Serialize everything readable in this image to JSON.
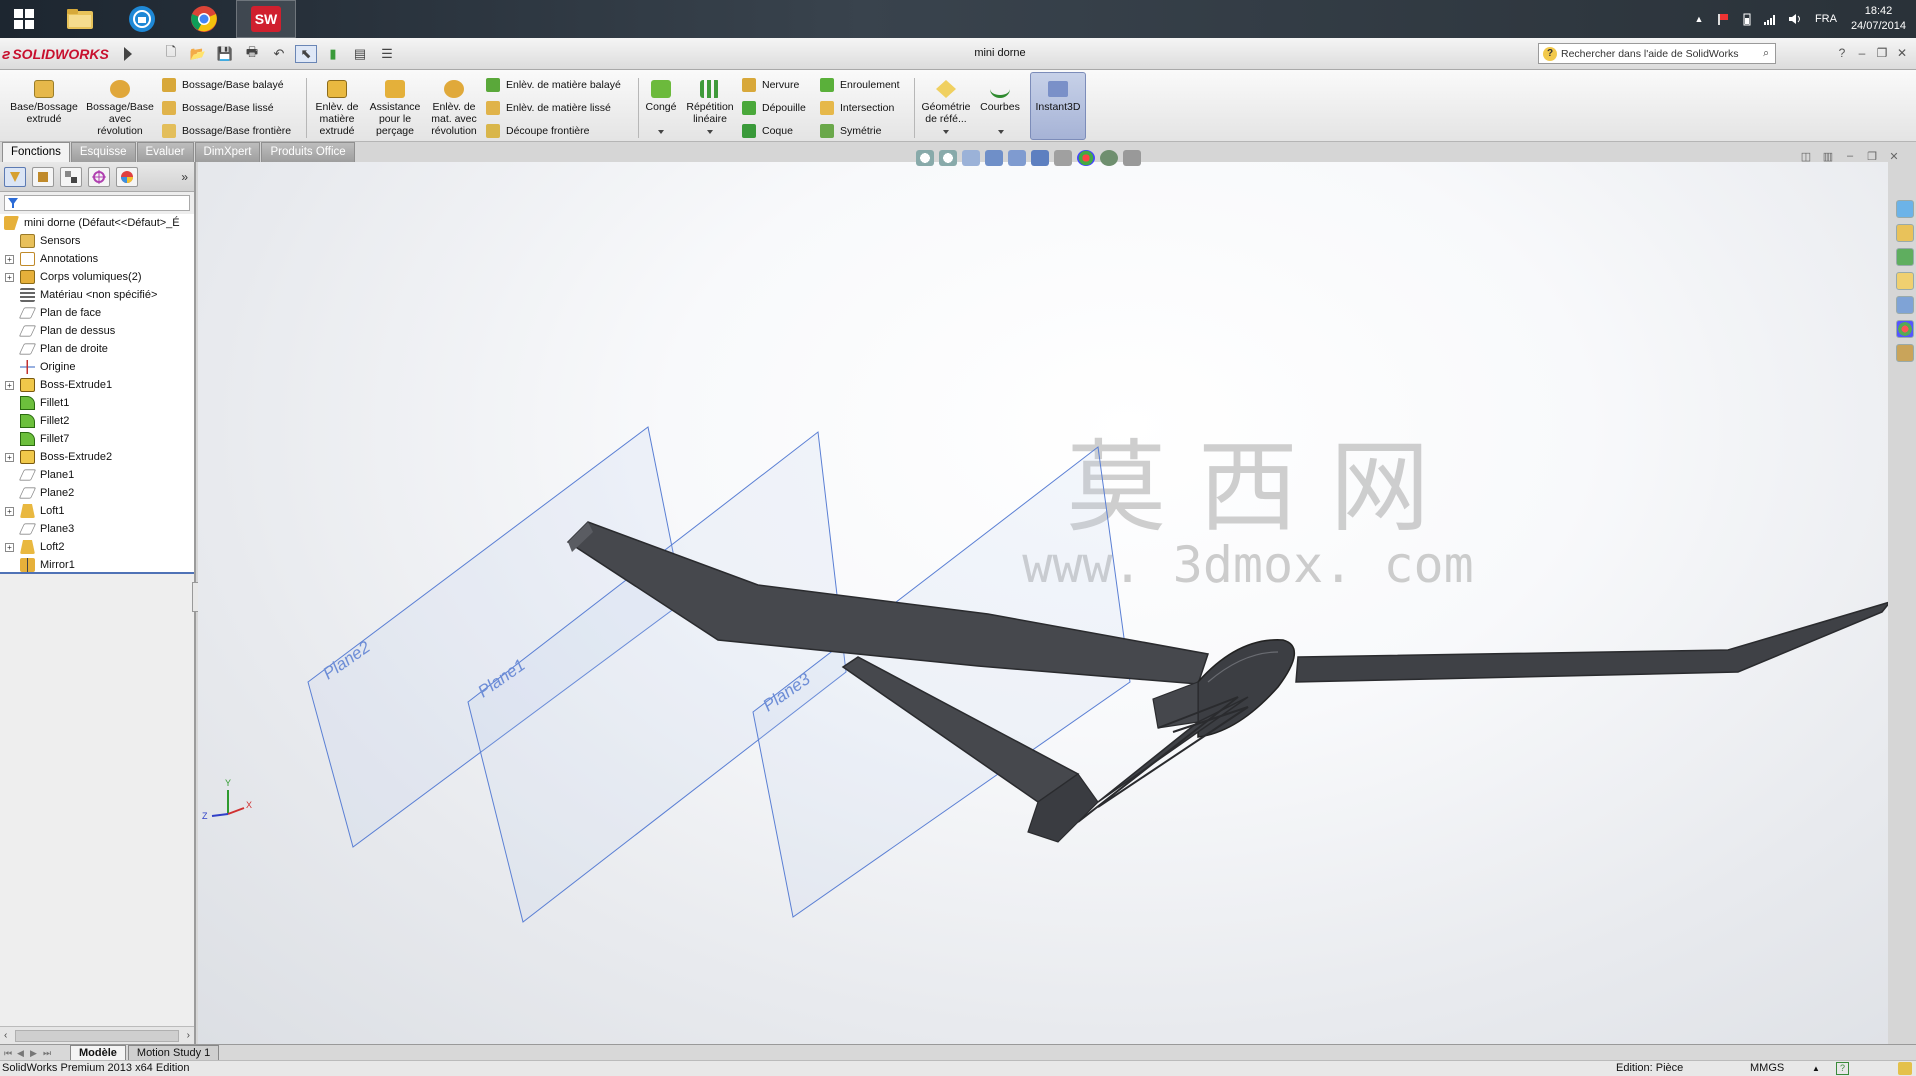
{
  "taskbar": {
    "apps": [
      {
        "name": "start-button",
        "icon": "windows-logo-icon"
      },
      {
        "name": "explorer",
        "icon": "folder-icon"
      },
      {
        "name": "app-blue",
        "icon": "blue-app-icon"
      },
      {
        "name": "chrome",
        "icon": "chrome-icon"
      },
      {
        "name": "solidworks",
        "icon": "solidworks-icon",
        "label": "SW",
        "active": true
      }
    ],
    "tray": {
      "language": "FRA",
      "time": "18:42",
      "date": "24/07/2014"
    }
  },
  "app": {
    "brand": "SOLIDWORKS",
    "document_title": "mini dorne",
    "help_search_placeholder": "Rechercher dans l'aide de SolidWorks",
    "colors": {
      "brand_red": "#c8102e",
      "selection_blue": "#4f72b6",
      "model_gray": "#3f4146",
      "plane_blue": "#5a7fd4"
    }
  },
  "ribbon": {
    "features": {
      "extrude": "Base/Bossage extrudé",
      "revolve": [
        "Bossage/Base",
        "avec",
        "révolution"
      ],
      "sweep": "Bossage/Base balayé",
      "loft": "Bossage/Base lissé",
      "boundary": "Bossage/Base frontière",
      "cut_extrude": [
        "Enlèv. de",
        "matière",
        "extrudé"
      ],
      "hole_wizard": [
        "Assistance",
        "pour le",
        "perçage"
      ],
      "cut_revolve": [
        "Enlèv. de",
        "mat. avec",
        "révolution"
      ],
      "cut_sweep": "Enlèv. de matière balayé",
      "cut_loft": "Enlèv. de matière lissé",
      "cut_boundary": "Découpe frontière",
      "fillet": "Congé",
      "linear_pattern": [
        "Répétition",
        "linéaire"
      ],
      "rib": "Nervure",
      "draft": "Dépouille",
      "shell": "Coque",
      "wrap": "Enroulement",
      "intersect": "Intersection",
      "mirror": "Symétrie",
      "ref_geometry": [
        "Géométrie",
        "de réfé..."
      ],
      "curves": "Courbes",
      "instant3d": "Instant3D"
    }
  },
  "cm_tabs": [
    "Fonctions",
    "Esquisse",
    "Evaluer",
    "DimXpert",
    "Produits Office"
  ],
  "feature_tree": {
    "root": "mini dorne  (Défaut<<Défaut>_É",
    "items": [
      {
        "label": "Sensors",
        "icon": "sensors-icon",
        "expandable": false
      },
      {
        "label": "Annotations",
        "icon": "annotations-icon",
        "expandable": true
      },
      {
        "label": "Corps volumiques(2)",
        "icon": "solid-bodies-icon",
        "expandable": true
      },
      {
        "label": "Matériau <non spécifié>",
        "icon": "material-icon",
        "expandable": false
      },
      {
        "label": "Plan de face",
        "icon": "plane-icon",
        "expandable": false
      },
      {
        "label": "Plan de dessus",
        "icon": "plane-icon",
        "expandable": false
      },
      {
        "label": "Plan de droite",
        "icon": "plane-icon",
        "expandable": false
      },
      {
        "label": "Origine",
        "icon": "origin-icon",
        "expandable": false
      },
      {
        "label": "Boss-Extrude1",
        "icon": "extrude-icon",
        "expandable": true
      },
      {
        "label": "Fillet1",
        "icon": "fillet-icon",
        "expandable": false
      },
      {
        "label": "Fillet2",
        "icon": "fillet-icon",
        "expandable": false
      },
      {
        "label": "Fillet7",
        "icon": "fillet-icon",
        "expandable": false
      },
      {
        "label": "Boss-Extrude2",
        "icon": "extrude-icon",
        "expandable": true
      },
      {
        "label": "Plane1",
        "icon": "plane-icon",
        "expandable": false
      },
      {
        "label": "Plane2",
        "icon": "plane-icon",
        "expandable": false
      },
      {
        "label": "Loft1",
        "icon": "loft-icon",
        "expandable": true
      },
      {
        "label": "Plane3",
        "icon": "plane-icon",
        "expandable": false
      },
      {
        "label": "Loft2",
        "icon": "loft-icon",
        "expandable": true
      },
      {
        "label": "Mirror1",
        "icon": "mirror-icon",
        "expandable": false
      }
    ]
  },
  "viewport": {
    "planes": [
      "Plane2",
      "Plane1",
      "Plane3"
    ],
    "watermark": {
      "chinese": "莫 西 网",
      "url": "www. 3dmox. com"
    },
    "triad": {
      "x": "X",
      "y": "Y",
      "z": "Z"
    }
  },
  "bottom_tabs": [
    "Modèle",
    "Motion Study 1"
  ],
  "status": {
    "edition": "SolidWorks Premium 2013 x64 Edition",
    "editing": "Edition: Pièce",
    "units": "MMGS"
  }
}
